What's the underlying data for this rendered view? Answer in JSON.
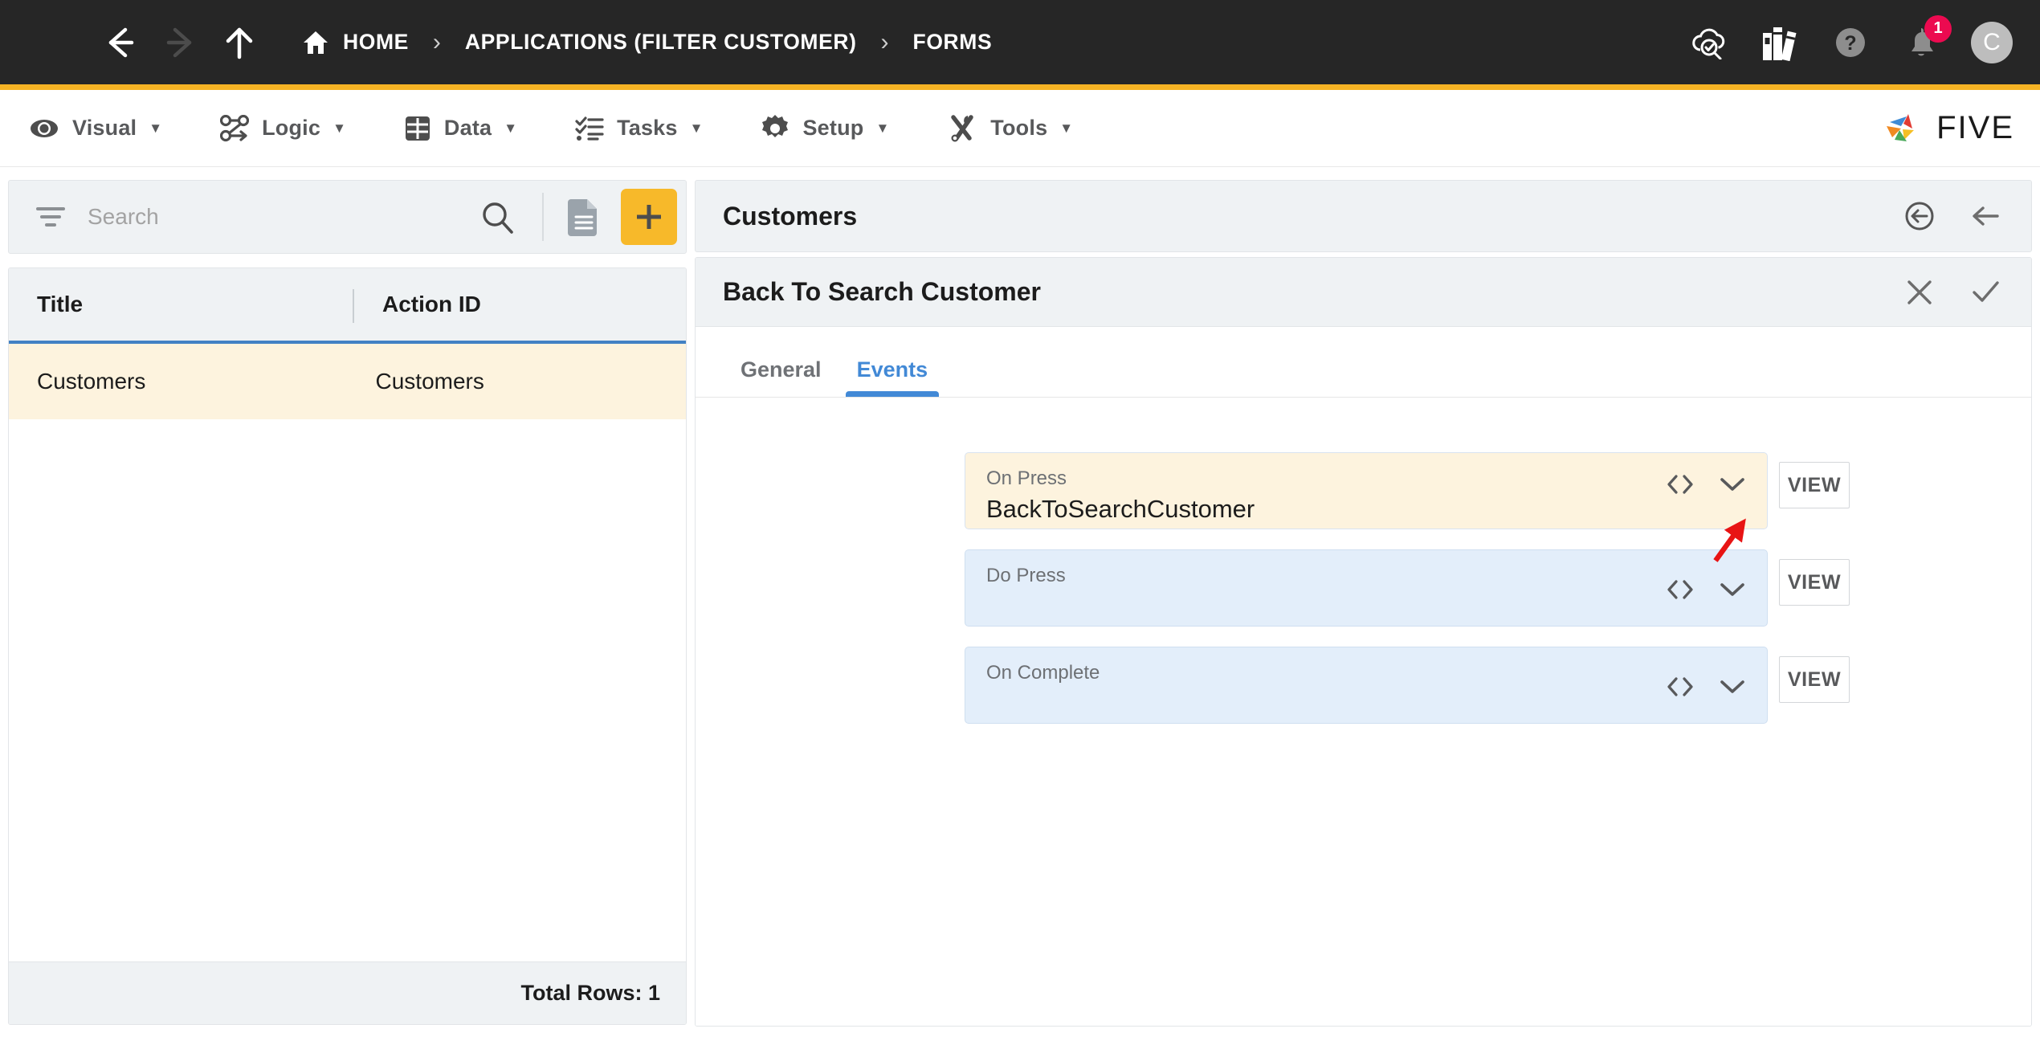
{
  "topbar": {
    "menu_icon": "hamburger-icon",
    "back_icon": "arrow-left-icon",
    "forward_icon": "arrow-right-icon",
    "up_icon": "arrow-up-icon",
    "breadcrumb": [
      {
        "label": "HOME",
        "icon": "home-icon"
      },
      {
        "label": "APPLICATIONS (FILTER CUSTOMER)",
        "icon": ""
      },
      {
        "label": "FORMS",
        "icon": ""
      }
    ],
    "separator": "›",
    "right_icons": [
      {
        "name": "cloud-check-icon"
      },
      {
        "name": "books-icon"
      },
      {
        "name": "help-icon"
      },
      {
        "name": "bell-icon",
        "badge": "1"
      }
    ],
    "avatar_initial": "C"
  },
  "menubar": {
    "items": [
      {
        "label": "Visual",
        "icon": "eye-icon",
        "caret": "▼"
      },
      {
        "label": "Logic",
        "icon": "flow-icon",
        "caret": "▼"
      },
      {
        "label": "Data",
        "icon": "table-icon",
        "caret": "▼"
      },
      {
        "label": "Tasks",
        "icon": "checklist-icon",
        "caret": "▼"
      },
      {
        "label": "Setup",
        "icon": "gear-icon",
        "caret": "▼"
      },
      {
        "label": "Tools",
        "icon": "tools-icon",
        "caret": "▼"
      }
    ],
    "brand": "FIVE"
  },
  "left_panel": {
    "search": {
      "placeholder": "Search",
      "value": ""
    },
    "toolbar": {
      "filter_icon": "filter-icon",
      "search_icon": "search-icon",
      "doc_icon": "document-icon",
      "add_label": "+"
    },
    "grid": {
      "columns": [
        "Title",
        "Action ID"
      ],
      "rows": [
        {
          "title": "Customers",
          "action_id": "Customers"
        }
      ],
      "footer": "Total Rows: 1"
    }
  },
  "right_panel": {
    "header": {
      "title": "Customers",
      "icons": [
        {
          "name": "back-circle-icon"
        },
        {
          "name": "arrow-left-icon"
        }
      ]
    },
    "subheader": {
      "title": "Back To Search Customer",
      "icons": [
        {
          "name": "close-icon"
        },
        {
          "name": "check-icon"
        }
      ]
    },
    "tabs": [
      {
        "label": "General",
        "active": false
      },
      {
        "label": "Events",
        "active": true
      }
    ],
    "events": [
      {
        "label": "On Press",
        "value": "BackToSearchCustomer",
        "highlight": "yellow",
        "view_label": "VIEW"
      },
      {
        "label": "Do Press",
        "value": "",
        "highlight": "blue",
        "view_label": "VIEW"
      },
      {
        "label": "On Complete",
        "value": "",
        "highlight": "blue",
        "view_label": "VIEW"
      }
    ]
  },
  "colors": {
    "topbar_bg": "#262626",
    "accent_yellow": "#f5b324",
    "badge_red": "#ec0a50",
    "tab_blue": "#4289d6",
    "row_highlight": "#fdf3de",
    "field_blue": "#e3eefa",
    "annotation_red": "#e81414"
  },
  "annotation": {
    "type": "arrow",
    "color": "#e81414",
    "points_to": "on-press-chevron-down-icon"
  }
}
